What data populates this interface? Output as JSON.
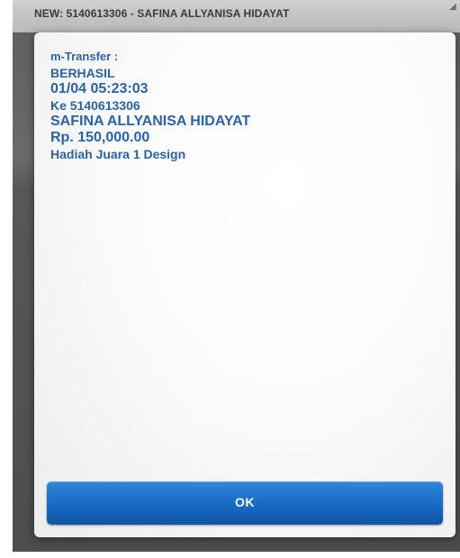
{
  "header": {
    "title": "NEW: 5140613306 - SAFINA ALLYANISA HIDAYAT"
  },
  "dialog": {
    "lines": [
      "m-Transfer :",
      "BERHASIL",
      "01/04 05:23:03",
      "Ke 5140613306",
      "SAFINA ALLYANISA HIDAYAT",
      "Rp. 150,000.00",
      "Hadiah Juara 1 Design"
    ],
    "ok_label": "OK"
  },
  "colors": {
    "message_text": "#2a63a8",
    "button": "#1a6cc4",
    "backdrop": "#5e5e5e"
  }
}
